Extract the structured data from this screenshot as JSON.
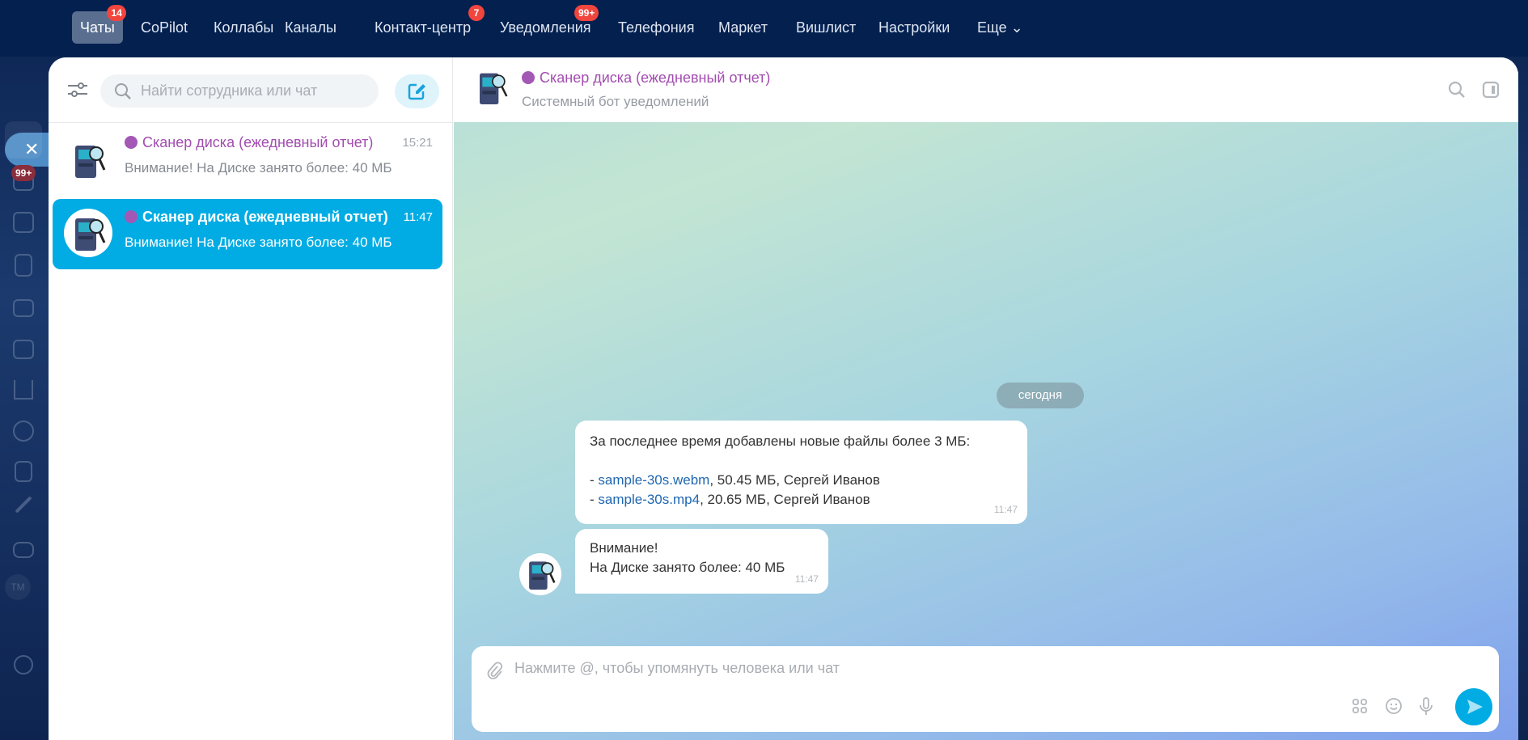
{
  "topnav": {
    "tabs": [
      {
        "label": "Чаты",
        "badge": "14",
        "active": true
      },
      {
        "label": "CoPilot"
      },
      {
        "label": "Коллабы"
      },
      {
        "label": "Каналы"
      },
      {
        "label": "Контакт-центр",
        "badge": "7"
      },
      {
        "label": "Уведомления",
        "badge": "99+"
      },
      {
        "label": "Телефония"
      },
      {
        "label": "Маркет"
      },
      {
        "label": "Вишлист"
      },
      {
        "label": "Настройки"
      },
      {
        "label": "Еще ⌄"
      }
    ]
  },
  "rail": {
    "tasks_badge": "99+",
    "tm_label": "TM"
  },
  "chat_list": {
    "search_placeholder": "Найти сотрудника или чат",
    "items": [
      {
        "title": "Сканер диска (ежедневный отчет)",
        "time": "15:21",
        "message": "Внимание! На Диске занято более: 40 МБ",
        "selected": false
      },
      {
        "title": "Сканер диска (ежедневный отчет)",
        "time": "11:47",
        "message": "Внимание! На Диске занято более: 40 МБ",
        "selected": true
      }
    ]
  },
  "chat": {
    "title": "Сканер диска (ежедневный отчет)",
    "subtitle": "Системный бот уведомлений",
    "date_divider": "сегодня",
    "messages": [
      {
        "intro": "За последнее время добавлены новые файлы более 3 МБ:",
        "files": [
          {
            "prefix": "- ",
            "name": "sample-30s.webm",
            "details": ", 50.45 МБ, Сергей Иванов"
          },
          {
            "prefix": "- ",
            "name": "sample-30s.mp4",
            "details": ", 20.65 МБ, Сергей Иванов"
          }
        ],
        "time": "11:47"
      },
      {
        "line1": "Внимание!",
        "line2": "На Диске занято более: 40 МБ",
        "time": "11:47"
      }
    ],
    "input_placeholder": "Нажмите @, чтобы упомянуть человека или чат"
  },
  "colors": {
    "accent": "#00ace3",
    "bot_name": "#a24db0",
    "nav_bg": "#03204f",
    "badge": "#f1453d"
  }
}
